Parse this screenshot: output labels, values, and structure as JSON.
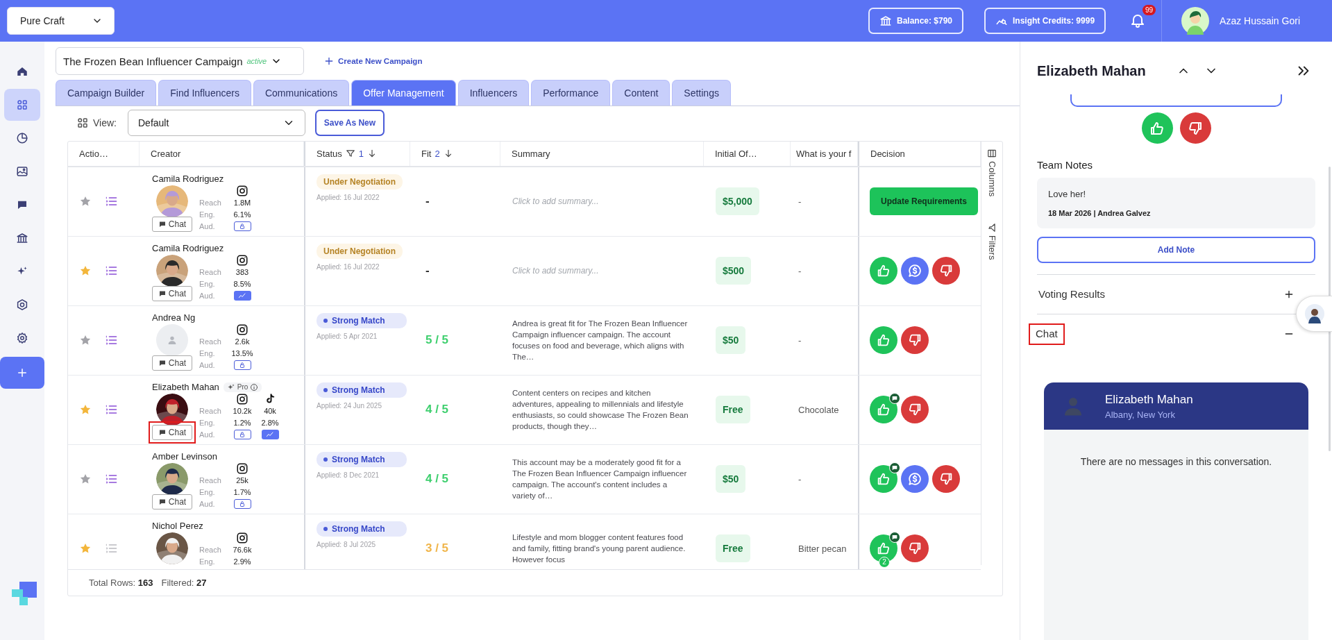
{
  "top_bar": {
    "workspace": "Pure Craft",
    "balance": "Balance: $790",
    "credits": "Insight Credits: 9999",
    "notifications": "99",
    "user": "Azaz Hussain Gori"
  },
  "sidebar": {
    "items": [
      {
        "kind": "home",
        "selected": false
      },
      {
        "kind": "campaigns",
        "selected": true
      },
      {
        "kind": "analytics",
        "selected": false
      },
      {
        "kind": "media",
        "selected": false
      },
      {
        "kind": "messages",
        "selected": false
      },
      {
        "kind": "payments",
        "selected": false
      },
      {
        "kind": "ai",
        "selected": false
      },
      {
        "kind": "integrations",
        "selected": false
      },
      {
        "kind": "settings",
        "selected": false
      }
    ]
  },
  "campaign": {
    "name": "The Frozen Bean Influencer Campaign",
    "status": "active",
    "create_link": "Create New Campaign"
  },
  "tabs": [
    {
      "label": "Campaign Builder",
      "selected": false
    },
    {
      "label": "Find Influencers",
      "selected": false
    },
    {
      "label": "Communications",
      "selected": false
    },
    {
      "label": "Offer Management",
      "selected": true
    },
    {
      "label": "Influencers",
      "selected": false
    },
    {
      "label": "Performance",
      "selected": false
    },
    {
      "label": "Content",
      "selected": false
    },
    {
      "label": "Settings",
      "selected": false
    }
  ],
  "view": {
    "label": "View:",
    "value": "Default",
    "save": "Save As New"
  },
  "table": {
    "columns": [
      {
        "label": "Actio…",
        "filter": false,
        "sorted": false
      },
      {
        "label": "Creator",
        "filter": false,
        "sorted": false
      },
      {
        "label": "Status",
        "filter": true,
        "sorted": true,
        "sort_order": "1"
      },
      {
        "label": "Fit",
        "filter": false,
        "sorted": true,
        "sort_order": "2"
      },
      {
        "label": "Summary",
        "filter": false,
        "sorted": false
      },
      {
        "label": "Initial Of…",
        "filter": false,
        "sorted": false
      },
      {
        "label": "What is your f",
        "filter": false,
        "sorted": false
      },
      {
        "label": "Decision",
        "filter": false,
        "sorted": false
      }
    ],
    "rows": [
      {
        "starred": false,
        "list_active": true,
        "name": "Camila Rodriguez",
        "photo": true,
        "chat": "Chat",
        "chat_highlighted": false,
        "metric_labels": [
          "Reach",
          "Eng.",
          "Aud."
        ],
        "platforms": [
          {
            "kind": "instagram",
            "reach": "1.8M",
            "eng": "6.1%",
            "audience_unlocked": false
          }
        ],
        "status": {
          "kind": "negotiation",
          "label": "Under Negotiation"
        },
        "applied": "Applied: 16 Jul 2022",
        "fit": {
          "text": "-",
          "color": "#333333"
        },
        "summary": {
          "kind": "placeholder",
          "text": "Click to add summary..."
        },
        "offer": "$5,000",
        "answer": "-",
        "decision": {
          "kind": "button",
          "label": "Update Requirements"
        }
      },
      {
        "starred": true,
        "list_active": true,
        "name": "Camila Rodriguez",
        "photo": true,
        "chat": "Chat",
        "chat_highlighted": false,
        "metric_labels": [
          "Reach",
          "Eng.",
          "Aud."
        ],
        "platforms": [
          {
            "kind": "instagram",
            "reach": "383",
            "eng": "8.5%",
            "audience_unlocked": true
          }
        ],
        "status": {
          "kind": "negotiation",
          "label": "Under Negotiation"
        },
        "applied": "Applied: 16 Jul 2022",
        "fit": {
          "text": "-",
          "color": "#333333"
        },
        "summary": {
          "kind": "placeholder",
          "text": "Click to add summary..."
        },
        "offer": "$500",
        "answer": "-",
        "decision": {
          "kind": "votes",
          "votes": [
            {
              "kind": "approve",
              "comment": false
            },
            {
              "kind": "negotiate"
            },
            {
              "kind": "reject"
            }
          ]
        }
      },
      {
        "starred": false,
        "list_active": true,
        "name": "Andrea Ng",
        "photo": false,
        "chat": "Chat",
        "chat_highlighted": false,
        "metric_labels": [
          "Reach",
          "Eng.",
          "Aud."
        ],
        "platforms": [
          {
            "kind": "instagram",
            "reach": "2.6k",
            "eng": "13.5%",
            "audience_unlocked": false
          }
        ],
        "status": {
          "kind": "match",
          "label": "Strong Match"
        },
        "applied": "Applied: 5 Apr 2021",
        "fit": {
          "text": "5 / 5",
          "color": "#3ecf6e"
        },
        "summary": {
          "kind": "text",
          "text": "Andrea is great fit for The Frozen Bean Influencer Campaign influencer campaign. The account focuses on food and beverage, which aligns with The…"
        },
        "offer": "$50",
        "answer": "-",
        "decision": {
          "kind": "votes",
          "votes": [
            {
              "kind": "approve",
              "comment": false
            },
            {
              "kind": "reject"
            }
          ]
        }
      },
      {
        "starred": true,
        "list_active": true,
        "name": "Elizabeth Mahan",
        "badge": "Pro",
        "photo": true,
        "chat": "Chat",
        "chat_highlighted": true,
        "metric_labels": [
          "Reach",
          "Eng.",
          "Aud."
        ],
        "platforms": [
          {
            "kind": "instagram",
            "reach": "10.2k",
            "eng": "1.2%",
            "audience_unlocked": false
          },
          {
            "kind": "tiktok",
            "reach": "40k",
            "eng": "2.8%",
            "audience_unlocked": true
          }
        ],
        "status": {
          "kind": "match",
          "label": "Strong Match"
        },
        "applied": "Applied: 24 Jun 2025",
        "fit": {
          "text": "4 / 5",
          "color": "#3ecf6e"
        },
        "summary": {
          "kind": "text",
          "text": "Content centers on recipes and kitchen adventures, appealing to millennials and lifestyle enthusiasts, so could showcase The Frozen Bean products, though they…"
        },
        "offer": "Free",
        "answer": "Chocolate",
        "decision": {
          "kind": "votes",
          "votes": [
            {
              "kind": "approve",
              "comment": true
            },
            {
              "kind": "reject"
            }
          ]
        }
      },
      {
        "starred": false,
        "list_active": true,
        "name": "Amber Levinson",
        "photo": true,
        "chat": "Chat",
        "chat_highlighted": false,
        "metric_labels": [
          "Reach",
          "Eng.",
          "Aud."
        ],
        "platforms": [
          {
            "kind": "instagram",
            "reach": "25k",
            "eng": "1.7%",
            "audience_unlocked": false
          }
        ],
        "status": {
          "kind": "match",
          "label": "Strong Match"
        },
        "applied": "Applied: 8 Dec 2021",
        "fit": {
          "text": "4 / 5",
          "color": "#3ecf6e"
        },
        "summary": {
          "kind": "text",
          "text": "This account may be a moderately good fit for a The Frozen Bean Influencer Campaign influencer campaign. The account's content includes a variety of…"
        },
        "offer": "$50",
        "answer": "-",
        "decision": {
          "kind": "votes",
          "votes": [
            {
              "kind": "approve",
              "comment": true
            },
            {
              "kind": "negotiate"
            },
            {
              "kind": "reject"
            }
          ]
        }
      },
      {
        "starred": true,
        "list_active": false,
        "name": "Nichol Perez",
        "photo": true,
        "metric_labels": [
          "Reach",
          "Eng."
        ],
        "platforms": [
          {
            "kind": "instagram",
            "reach": "76.6k",
            "eng": "2.9%"
          }
        ],
        "status": {
          "kind": "match",
          "label": "Strong Match"
        },
        "applied": "Applied: 8 Jul 2025",
        "fit": {
          "text": "3 / 5",
          "color": "#f0b54a"
        },
        "summary": {
          "kind": "text",
          "text": "Lifestyle and mom blogger content features food and family, fitting brand's young parent audience. However focus"
        },
        "offer": "Free",
        "answer": "Bitter pecan",
        "decision": {
          "kind": "votes",
          "votes": [
            {
              "kind": "approve",
              "comment": true,
              "count": "2"
            },
            {
              "kind": "reject"
            }
          ]
        }
      }
    ],
    "side_tools": [
      "Columns",
      "Filters"
    ],
    "footer": {
      "total": "Total Rows: **163**",
      "filtered": "Filtered: **27**"
    }
  },
  "panel": {
    "title": "Elizabeth Mahan",
    "votes": [
      {
        "kind": "approve"
      },
      {
        "kind": "reject"
      }
    ],
    "team_notes_title": "Team Notes",
    "notes": [
      {
        "text": "Love her!",
        "meta": "18 Mar 2026 | Andrea Galvez"
      }
    ],
    "add_note": "Add Note",
    "sections": [
      {
        "title": "Voting Results",
        "expanded": false,
        "highlighted": false
      },
      {
        "title": "Chat",
        "expanded": true,
        "highlighted": true
      }
    ],
    "chat": {
      "name": "Elizabeth Mahan",
      "location": "Albany, New York",
      "empty": "There are no messages in this conversation."
    }
  }
}
